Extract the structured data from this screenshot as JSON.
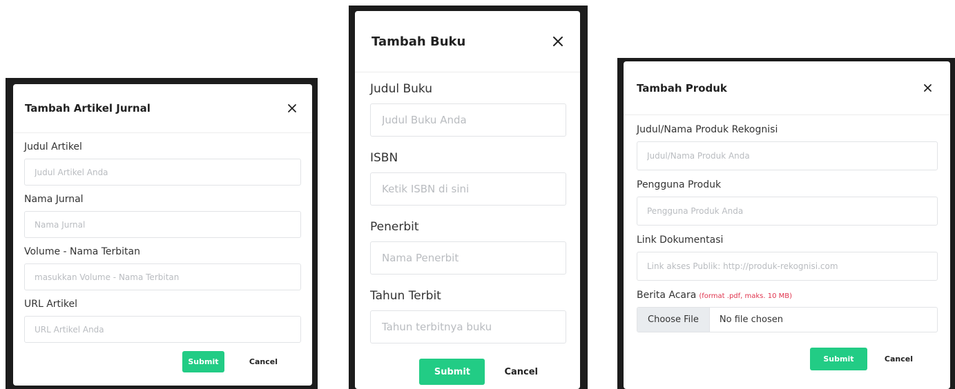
{
  "modals": {
    "jurnal": {
      "title": "Tambah Artikel Jurnal",
      "fields": [
        {
          "label": "Judul Artikel",
          "placeholder": "Judul Artikel Anda"
        },
        {
          "label": "Nama Jurnal",
          "placeholder": "Nama Jurnal"
        },
        {
          "label": "Volume - Nama Terbitan",
          "placeholder": "masukkan Volume - Nama Terbitan"
        },
        {
          "label": "URL Artikel",
          "placeholder": "URL Artikel Anda"
        }
      ],
      "submit_label": "Submit",
      "cancel_label": "Cancel"
    },
    "buku": {
      "title": "Tambah Buku",
      "fields": [
        {
          "label": "Judul Buku",
          "placeholder": "Judul Buku Anda"
        },
        {
          "label": "ISBN",
          "placeholder": "Ketik ISBN di sini"
        },
        {
          "label": "Penerbit",
          "placeholder": "Nama Penerbit"
        },
        {
          "label": "Tahun Terbit",
          "placeholder": "Tahun terbitnya buku"
        }
      ],
      "submit_label": "Submit",
      "cancel_label": "Cancel"
    },
    "produk": {
      "title": "Tambah Produk",
      "fields": [
        {
          "label": "Judul/Nama Produk Rekognisi",
          "placeholder": "Judul/Nama Produk Anda"
        },
        {
          "label": "Pengguna Produk",
          "placeholder": "Pengguna Produk Anda"
        },
        {
          "label": "Link Dokumentasi",
          "placeholder": "Link akses Publik: http://produk-rekognisi.com"
        }
      ],
      "file_field": {
        "label": "Berita Acara",
        "hint": "(format .pdf, maks. 10 MB)",
        "button_label": "Choose File",
        "status": "No file chosen"
      },
      "submit_label": "Submit",
      "cancel_label": "Cancel"
    }
  },
  "icons": {
    "close": "close-icon"
  },
  "colors": {
    "submit": "#22cc85",
    "hint": "#e0344e",
    "backdrop": "#1c1c1c"
  }
}
